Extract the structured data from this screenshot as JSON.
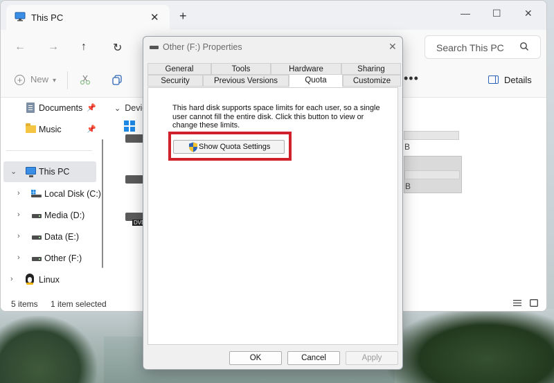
{
  "explorer": {
    "tab_title": "This PC",
    "tab_close": "✕",
    "new_tab": "+",
    "window_controls": {
      "minimize": "—",
      "maximize": "☐",
      "close": "✕"
    },
    "nav": {
      "back": "←",
      "forward": "→",
      "up": "↑",
      "refresh": "↻"
    },
    "search_placeholder": "Search This PC",
    "toolbar": {
      "new_label": "New",
      "more": "•••",
      "details_label": "Details"
    },
    "sidebar": {
      "documents": "Documents",
      "music": "Music",
      "this_pc": "This PC",
      "local_disk": "Local Disk (C:)",
      "media": "Media (D:)",
      "data": "Data (E:)",
      "other": "Other (F:)",
      "linux": "Linux"
    },
    "content": {
      "section_header": "Devic",
      "frag1": "B",
      "frag2": "B",
      "dvd": "DVD"
    },
    "status": {
      "items": "5 items",
      "selected": "1 item selected"
    }
  },
  "dialog": {
    "title": "Other (F:) Properties",
    "close": "✕",
    "tabs_row1": [
      "General",
      "Tools",
      "Hardware",
      "Sharing"
    ],
    "tabs_row2": [
      "Security",
      "Previous Versions",
      "Quota",
      "Customize"
    ],
    "active_tab": "Quota",
    "description": "This hard disk supports space limits for each user, so a single user cannot fill the entire disk. Click this button to view or change these limits.",
    "quota_button": "Show Quota Settings",
    "buttons": {
      "ok": "OK",
      "cancel": "Cancel",
      "apply": "Apply"
    }
  },
  "colors": {
    "highlight": "#d0202a",
    "accent": "#2a62b8",
    "selection": "#e3e5e8"
  }
}
